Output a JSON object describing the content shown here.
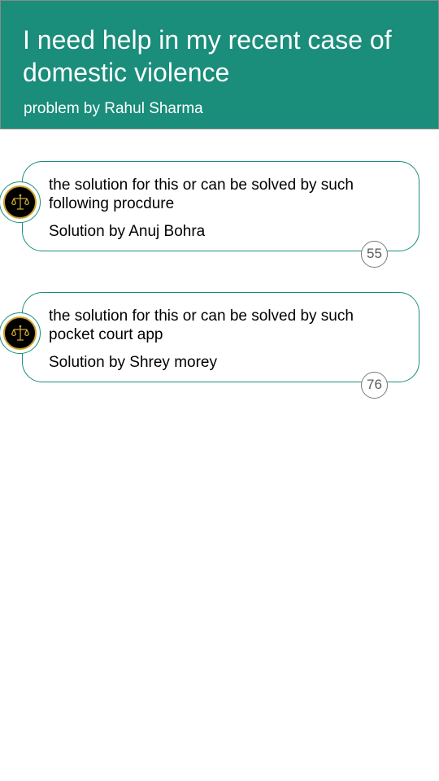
{
  "problem": {
    "title": "I need help in my recent case of domestic violence",
    "author_line": "problem by Rahul Sharma"
  },
  "solutions": [
    {
      "text": "the solution for this or can be solved by such following procdure",
      "author_line": "Solution by Anuj Bohra",
      "count": "55",
      "avatar_icon": "scales-of-justice-icon"
    },
    {
      "text": "the solution for this or can be solved by such pocket court app",
      "author_line": "Solution by Shrey morey",
      "count": "76",
      "avatar_icon": "scales-of-justice-icon"
    }
  ],
  "colors": {
    "header_bg": "#1a8d7b",
    "card_border": "#1a8d7b",
    "avatar_gold": "#c9a227"
  }
}
